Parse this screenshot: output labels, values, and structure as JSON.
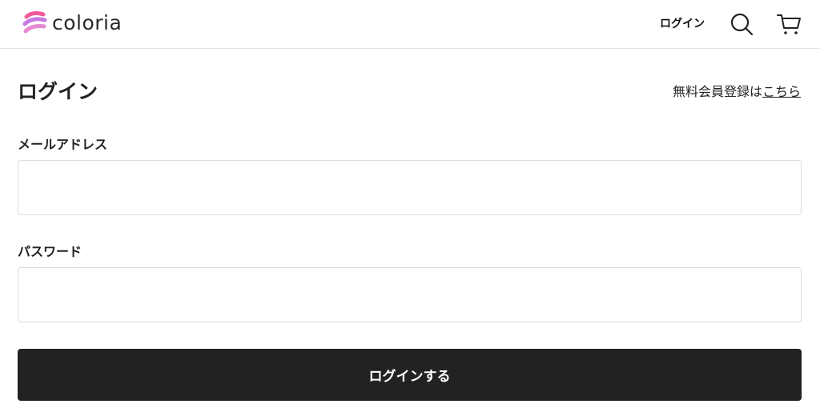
{
  "brand": {
    "name": "coloria",
    "logo_colors": [
      "#f05a9a",
      "#c778e0",
      "#e58ad0"
    ]
  },
  "header": {
    "login_link": "ログイン",
    "icons": [
      "search-icon",
      "cart-icon"
    ]
  },
  "main": {
    "title": "ログイン",
    "register_prefix": "無料会員登録は",
    "register_link": "こちら",
    "fields": [
      {
        "label": "メールアドレス",
        "value": "",
        "placeholder": ""
      },
      {
        "label": "パスワード",
        "value": "",
        "placeholder": ""
      }
    ],
    "submit_label": "ログインする"
  },
  "colors": {
    "button_bg": "#222222",
    "border": "#dcdcdc"
  }
}
